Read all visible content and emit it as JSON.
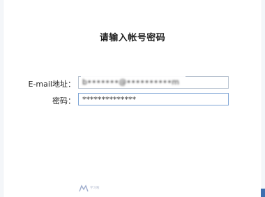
{
  "dialog": {
    "title": "请输入帐号密码",
    "email_label": "E-mail地址：",
    "email_value": "b•••••••@••••••••••m",
    "password_label": "密码：",
    "password_value": "**************"
  },
  "branding": {
    "logo_text": "学习啦"
  },
  "colors": {
    "accent_blue": "#7fa6d6",
    "corner_blue": "#3d6fb0"
  }
}
